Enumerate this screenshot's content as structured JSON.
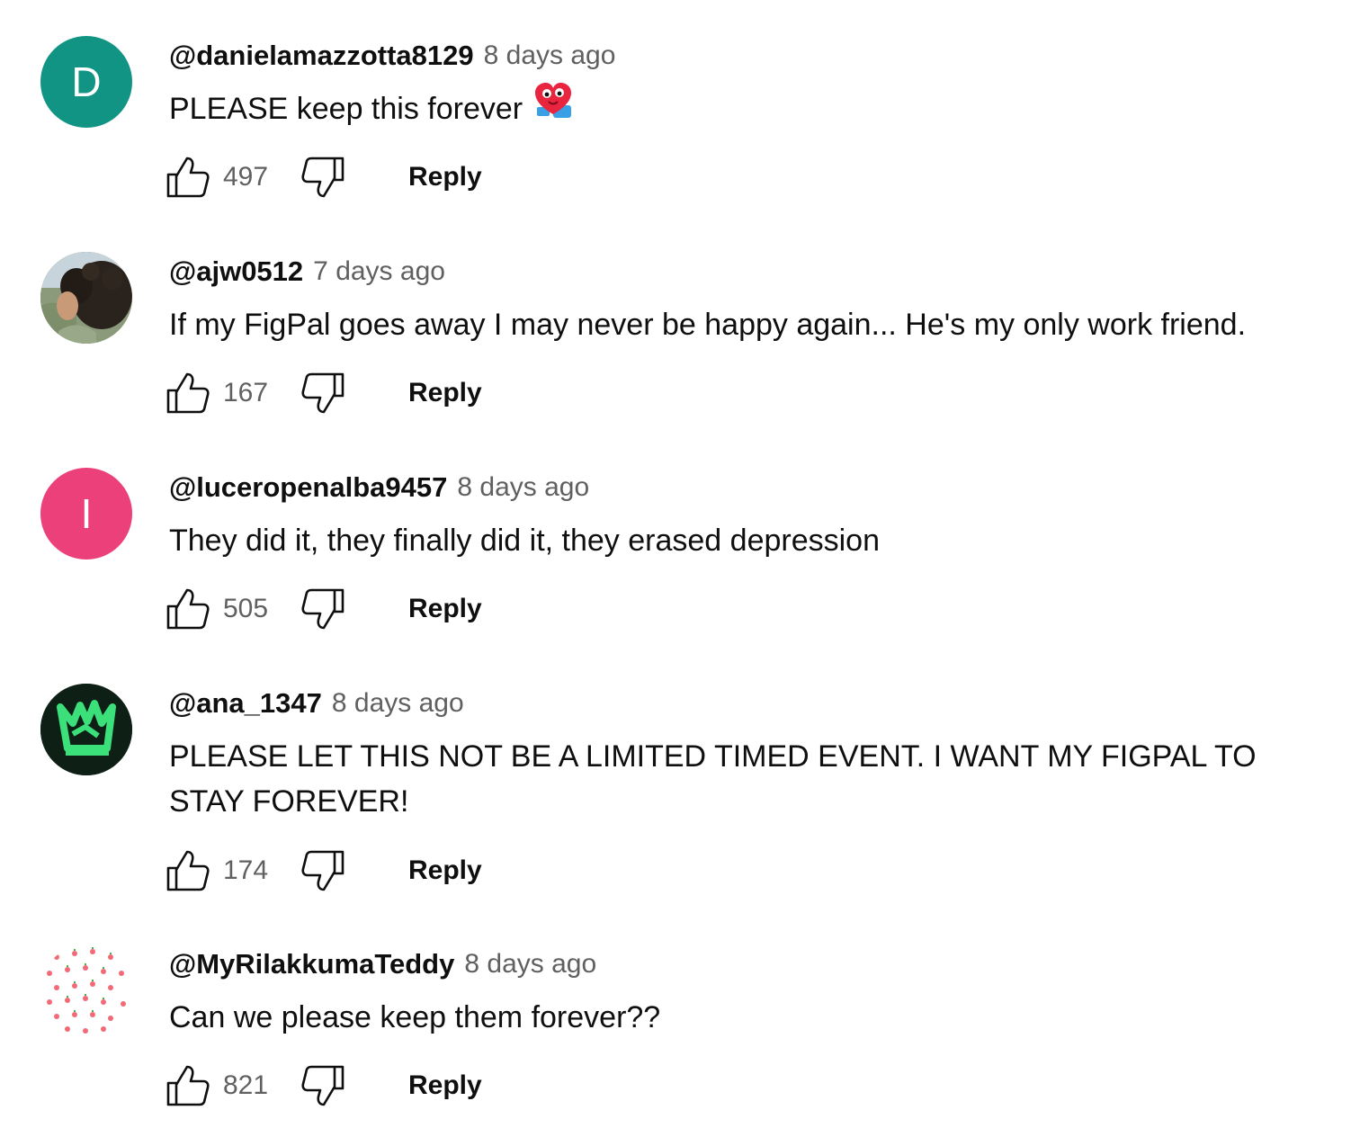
{
  "comments": [
    {
      "author": "@danielamazzotta8129",
      "time": "8 days ago",
      "text": "PLEASE keep this forever",
      "likes": "497",
      "reply_label": "Reply",
      "avatar": {
        "type": "letter",
        "letter": "D",
        "color": "#129484"
      },
      "emoji": "heart-face-emoji"
    },
    {
      "author": "@ajw0512",
      "time": "7 days ago",
      "text": "If my FigPal goes away I may never be happy again... He's my only work friend.",
      "likes": "167",
      "reply_label": "Reply",
      "avatar": {
        "type": "photo"
      }
    },
    {
      "author": "@luceropenalba9457",
      "time": "8 days ago",
      "text": "They did it, they finally did it, they erased depression",
      "likes": "505",
      "reply_label": "Reply",
      "avatar": {
        "type": "letter",
        "letter": "I",
        "color": "#ec407a"
      }
    },
    {
      "author": "@ana_1347",
      "time": "8 days ago",
      "text": "PLEASE LET THIS NOT BE A LIMITED TIMED EVENT. I WANT MY FIGPAL TO STAY FOREVER!",
      "likes": "174",
      "reply_label": "Reply",
      "avatar": {
        "type": "crown-logo",
        "color": "#0e2a1c",
        "accent": "#3be07a"
      }
    },
    {
      "author": "@MyRilakkumaTeddy",
      "time": "8 days ago",
      "text": "Can we please keep them forever??",
      "likes": "821",
      "reply_label": "Reply",
      "avatar": {
        "type": "strawberry-pattern",
        "accent": "#f06a78"
      }
    }
  ],
  "icons": {
    "like": "thumbs-up-icon",
    "dislike": "thumbs-down-icon"
  }
}
